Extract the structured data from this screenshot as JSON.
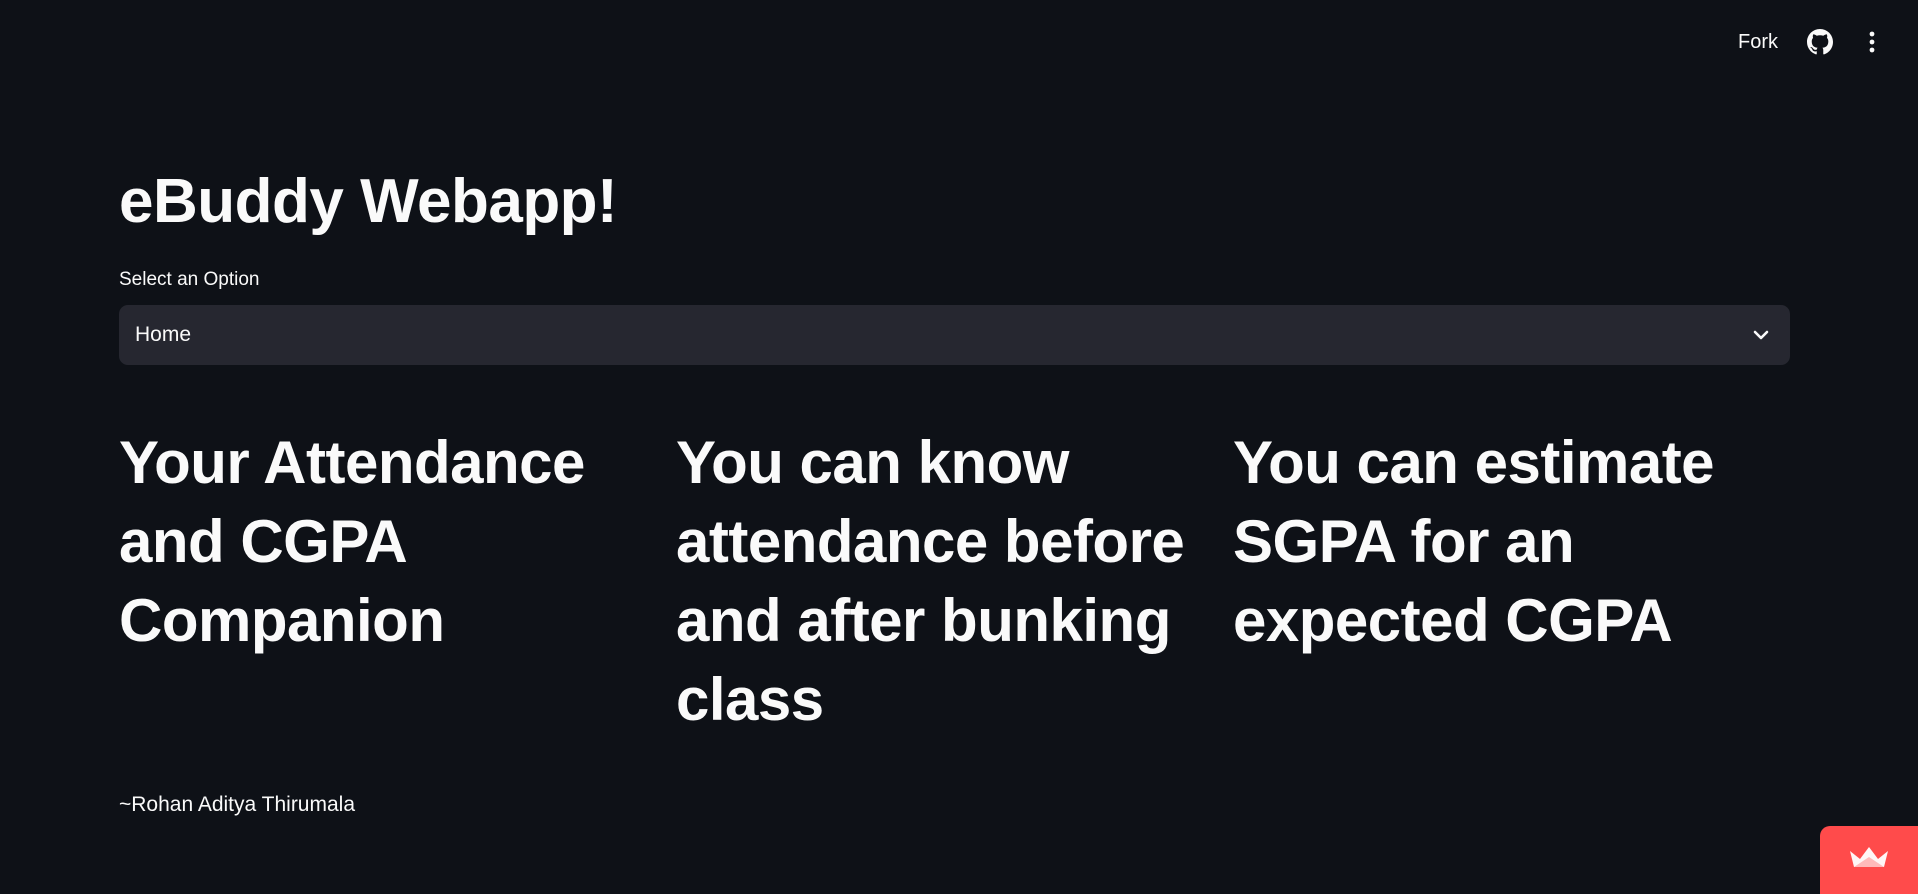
{
  "toolbar": {
    "fork_label": "Fork",
    "github_icon": "github-icon",
    "menu_icon": "more-vertical-icon"
  },
  "main": {
    "title": "eBuddy Webapp!",
    "select": {
      "label": "Select an Option",
      "value": "Home"
    },
    "columns": [
      "Your Attendance and CGPA Companion",
      "You can know attendance before and after bunking class",
      "You can estimate SGPA for an expected CGPA"
    ],
    "author": "~Rohan Aditya Thirumala"
  },
  "colors": {
    "background": "#0e1117",
    "select_background": "#262730",
    "text": "#fafafa",
    "badge": "#ff4b4b"
  },
  "badge": {
    "icon": "streamlit-crown-icon"
  }
}
